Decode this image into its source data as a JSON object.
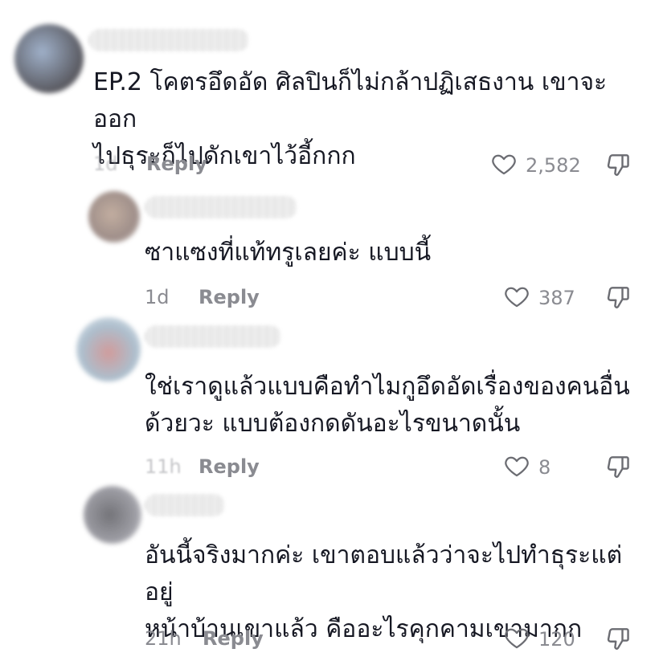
{
  "comments": [
    {
      "text": "EP.2 โคตรอึดอัด ศิลปินก็ไม่กล้าปฏิเสธงาน เขาจะออก\nไปธุระก็ไปดักเขาไว้อี้กกก",
      "time": "1d",
      "reply_label": "Reply",
      "likes": "2,582",
      "avatar_color": "#7a8ca6"
    },
    {
      "text": "ซาแซงที่แท้ทรูเลยค่ะ แบบนี้",
      "time": "1d",
      "reply_label": "Reply",
      "likes": "387",
      "avatar_color": "#a89080"
    },
    {
      "text": "ใช่เราดูแล้วแบบคือทำไมกูอึดอัดเรื่องของคนอื่น\nด้วยวะ แบบต้องกดดันอะไรขนาดนั้น",
      "time": "11h",
      "reply_label": "Reply",
      "likes": "8",
      "avatar_color": "#9fb3c4"
    },
    {
      "text": "อันนี้จริงมากค่ะ เขาตอบแล้วว่าจะไปทำธุระแต่ อยู่\nหน้าบ้านเขาแล้ว คืออะไรคุกคามเขามากก",
      "time": "21h",
      "reply_label": "Reply",
      "likes": "120",
      "avatar_color": "#6e6e74"
    }
  ],
  "icons": {
    "like": "heart-outline-icon",
    "dislike": "thumbs-down-outline-icon"
  },
  "colors": {
    "text": "#161823",
    "meta": "#8a8b91",
    "icon": "#6b6c72"
  }
}
